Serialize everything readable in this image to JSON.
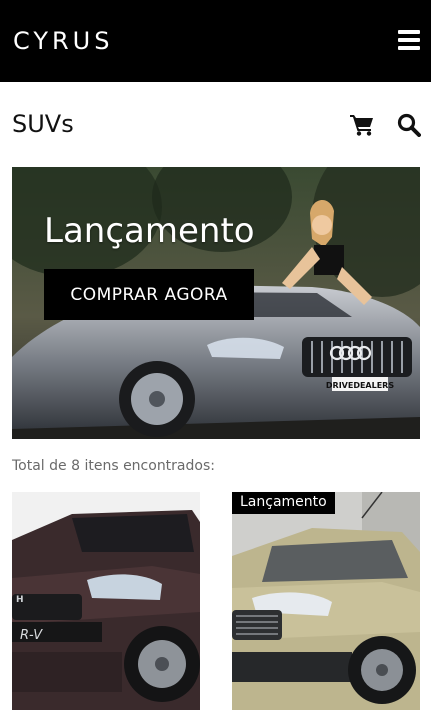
{
  "header": {
    "brand": "CYRUS",
    "menu_icon": "hamburger-menu-icon"
  },
  "page": {
    "title": "SUVs",
    "cart_icon": "cart-icon",
    "search_icon": "search-icon"
  },
  "banner": {
    "title": "Lançamento",
    "button_label": "COMPRAR AGORA",
    "plate_text": "DRIVEDEALERS"
  },
  "results": {
    "total_text": "Total de 8 itens encontrados:"
  },
  "products": [
    {
      "badge": "",
      "model_text": "R-V"
    },
    {
      "badge": "Lançamento"
    }
  ],
  "colors": {
    "header_bg": "#000000",
    "button_bg": "#000000",
    "text_muted": "#6a6a6a"
  }
}
